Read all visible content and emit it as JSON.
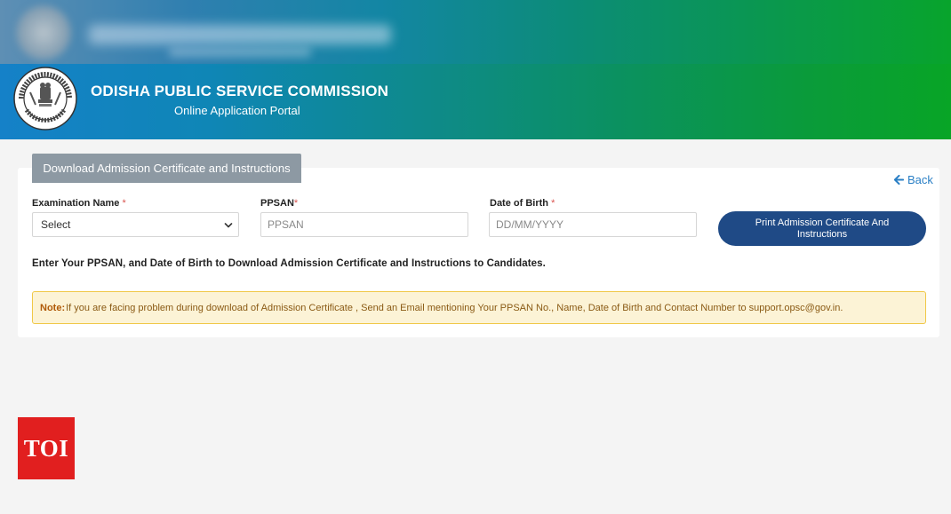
{
  "header": {
    "title": "ODISHA PUBLIC SERVICE COMMISSION",
    "subtitle": "Online Application Portal",
    "gradient_start": "#1581c8",
    "gradient_end": "#08a526",
    "logo_icon": "opsc-seal-icon"
  },
  "card": {
    "tab_label": "Download Admission Certificate and Instructions",
    "back_label": "Back",
    "fields": {
      "exam_label": "Examination Name",
      "exam_required": "*",
      "exam_value": "Select",
      "ppsan_label": "PPSAN",
      "ppsan_required": "*",
      "ppsan_placeholder": "PPSAN",
      "dob_label": "Date of Birth",
      "dob_required": "*",
      "dob_placeholder": "DD/MM/YYYY"
    },
    "print_button_label": "Print Admission Certificate And Instructions",
    "instruction": "Enter Your PPSAN, and Date of Birth to Download Admission Certificate and Instructions to Candidates.",
    "note_label": "Note:",
    "note_text": "If you are facing problem during download of Admission Certificate , Send an Email mentioning Your PPSAN No., Name, Date of Birth and Contact Number to support.opsc@gov.in."
  },
  "watermark": {
    "label": "TOI",
    "color": "#e11f1f"
  }
}
